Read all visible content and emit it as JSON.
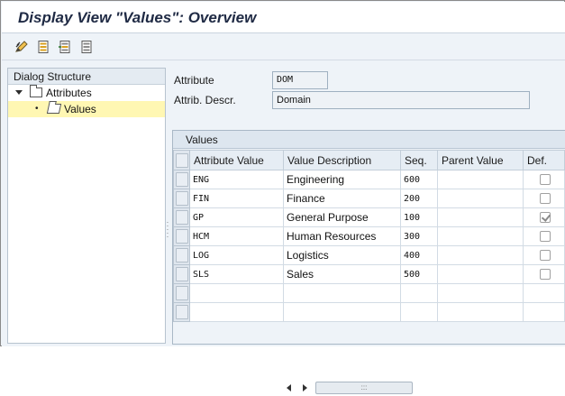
{
  "window": {
    "title": "Display View \"Values\": Overview"
  },
  "toolbar": {
    "buttons": [
      {
        "icon": "change-display-icon"
      },
      {
        "icon": "select-all-icon"
      },
      {
        "icon": "select-block-icon"
      },
      {
        "icon": "deselect-all-icon"
      }
    ]
  },
  "dialog_structure": {
    "header": "Dialog Structure",
    "items": [
      {
        "label": "Attributes",
        "level": 0,
        "expanded": true,
        "selected": false
      },
      {
        "label": "Values",
        "level": 1,
        "expanded": false,
        "selected": true
      }
    ]
  },
  "attribute": {
    "label": "Attribute",
    "value": "DOM",
    "descr_label": "Attrib. Descr.",
    "descr_value": "Domain"
  },
  "values_table": {
    "title": "Values",
    "columns": [
      "Attribute Value",
      "Value Description",
      "Seq.",
      "Parent Value",
      "Def."
    ],
    "rows": [
      {
        "attribute_value": "ENG",
        "description": "Engineering",
        "seq": "600",
        "parent": "",
        "default": false
      },
      {
        "attribute_value": "FIN",
        "description": "Finance",
        "seq": "200",
        "parent": "",
        "default": false
      },
      {
        "attribute_value": "GP",
        "description": "General Purpose",
        "seq": "100",
        "parent": "",
        "default": true
      },
      {
        "attribute_value": "HCM",
        "description": "Human Resources",
        "seq": "300",
        "parent": "",
        "default": false
      },
      {
        "attribute_value": "LOG",
        "description": "Logistics",
        "seq": "400",
        "parent": "",
        "default": false
      },
      {
        "attribute_value": "SLS",
        "description": "Sales",
        "seq": "500",
        "parent": "",
        "default": false
      }
    ],
    "empty_rows": 2
  },
  "colors": {
    "selection": "#fff7b3",
    "background": "#eef3f8"
  }
}
